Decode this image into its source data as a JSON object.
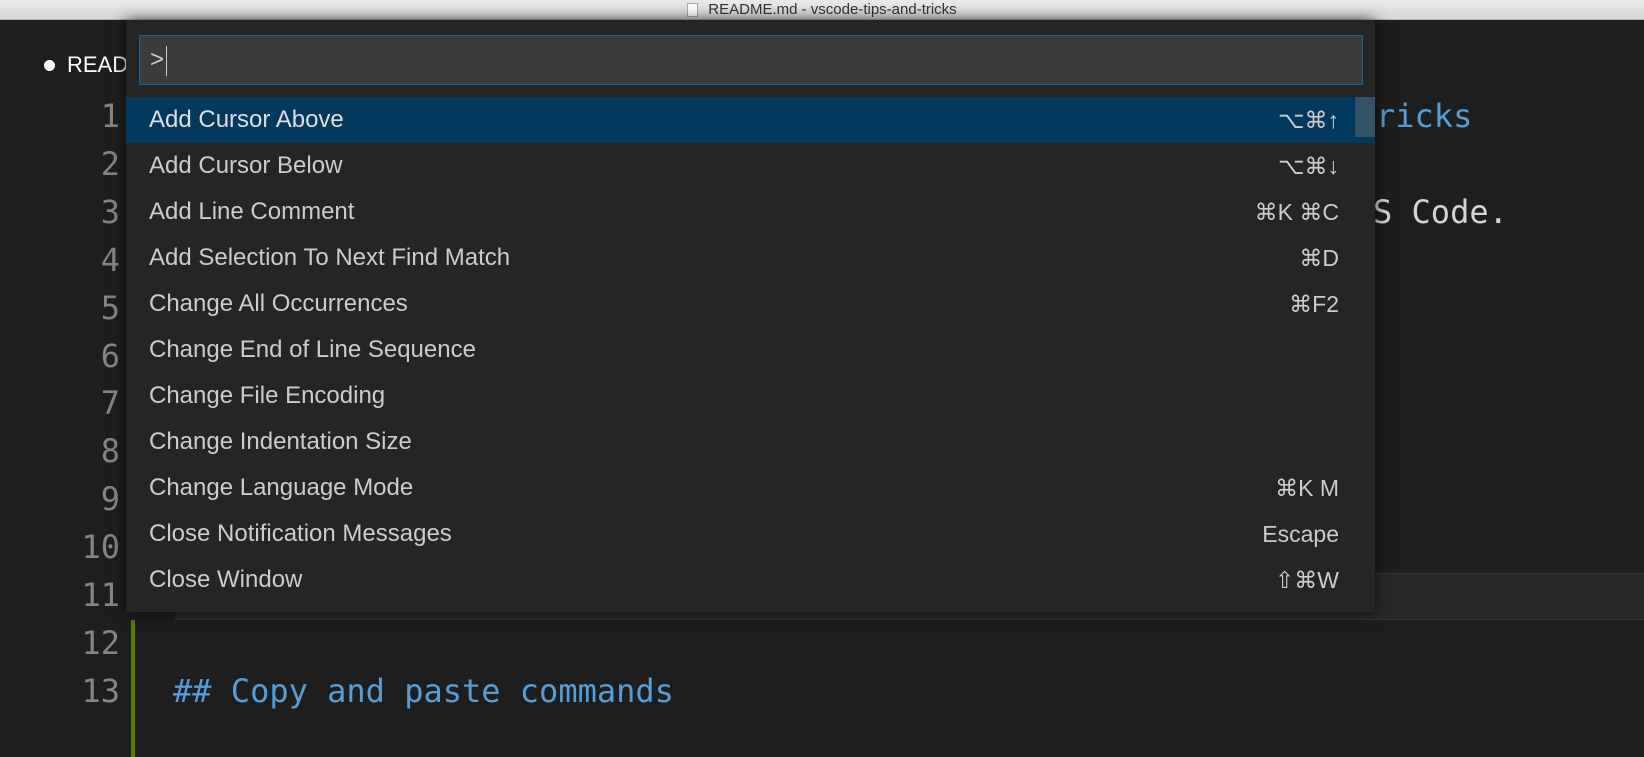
{
  "window": {
    "title": "README.md - vscode-tips-and-tricks"
  },
  "tab": {
    "label": "README.md",
    "dirty": true
  },
  "editor": {
    "line_numbers": [
      "1",
      "2",
      "3",
      "4",
      "5",
      "6",
      "7",
      "8",
      "9",
      "10",
      "11",
      "12",
      "13"
    ],
    "visible_fragments": {
      "line1": "ricks",
      "line3": "S Code.",
      "line13": "## Copy and paste commands"
    },
    "colors": {
      "heading": "#569cd6",
      "text": "#d4d4d4",
      "gutter_added": "#587c0c"
    }
  },
  "palette": {
    "input_value": ">",
    "items": [
      {
        "label": "Add Cursor Above",
        "keybinding": "⌥⌘↑",
        "selected": true
      },
      {
        "label": "Add Cursor Below",
        "keybinding": "⌥⌘↓"
      },
      {
        "label": "Add Line Comment",
        "keybinding": "⌘K ⌘C"
      },
      {
        "label": "Add Selection To Next Find Match",
        "keybinding": "⌘D"
      },
      {
        "label": "Change All Occurrences",
        "keybinding": "⌘F2"
      },
      {
        "label": "Change End of Line Sequence",
        "keybinding": ""
      },
      {
        "label": "Change File Encoding",
        "keybinding": ""
      },
      {
        "label": "Change Indentation Size",
        "keybinding": ""
      },
      {
        "label": "Change Language Mode",
        "keybinding": "⌘K M"
      },
      {
        "label": "Close Notification Messages",
        "keybinding": "Escape"
      },
      {
        "label": "Close Window",
        "keybinding": "⇧⌘W"
      }
    ],
    "colors": {
      "selected_bg": "#04395e",
      "bg": "#252526",
      "input_border": "#0e639c"
    }
  }
}
